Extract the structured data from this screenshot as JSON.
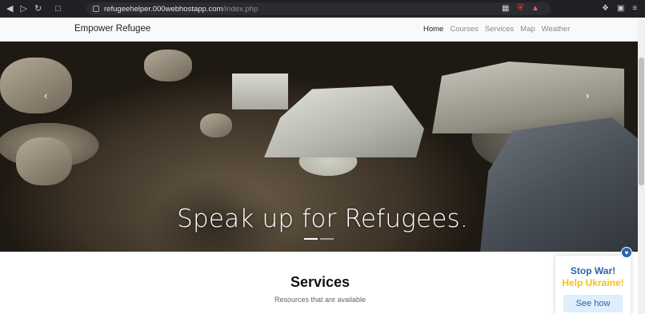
{
  "browser": {
    "url_host": "refugeehelper.000webhostapp.com",
    "url_path": "/index.php"
  },
  "navbar": {
    "brand": "Empower Refugee",
    "items": [
      {
        "label": "Home",
        "active": true
      },
      {
        "label": "Courses",
        "active": false
      },
      {
        "label": "Services",
        "active": false
      },
      {
        "label": "Map",
        "active": false
      },
      {
        "label": "Weather",
        "active": false
      }
    ]
  },
  "hero": {
    "caption": "Speak up for Refugees.",
    "prev_icon": "‹",
    "next_icon": "›",
    "slides_total": 2,
    "active_slide": 1
  },
  "services": {
    "title": "Services",
    "subtitle": "Resources that are available"
  },
  "widget": {
    "line1": "Stop War!",
    "line2": "Help Ukraine!",
    "button": "See how",
    "badge_icon": "heart-icon",
    "colors": {
      "blue": "#2f64a8",
      "yellow": "#f0c419"
    }
  }
}
